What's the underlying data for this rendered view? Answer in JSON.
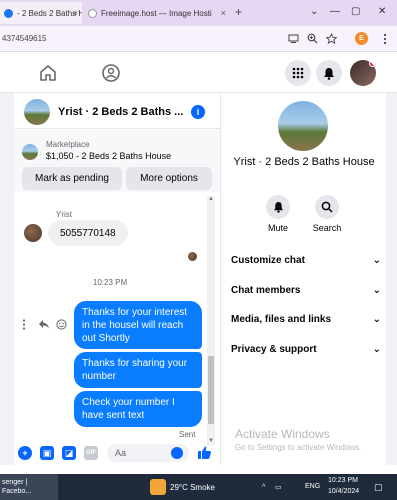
{
  "browser": {
    "tabs": [
      {
        "label": "- 2 Beds 2 Baths H",
        "close": "×"
      },
      {
        "label": "Freeimage.host — Image Hosti",
        "close": "×"
      }
    ],
    "new_tab": "+",
    "window_controls": [
      "⌄",
      "—",
      "▢",
      "✕"
    ],
    "url": "4374549615",
    "profile_initial": "E"
  },
  "chat": {
    "title": "Yrist · 2 Beds 2 Baths ...",
    "marketplace_label": "Marketplace",
    "listing": "$1,050 - 2 Beds 2 Baths House",
    "buttons": {
      "mark_pending": "Mark as pending",
      "more_options": "More options"
    },
    "messages_in": [
      {
        "sender": "Yrist",
        "text": "5055770148"
      }
    ],
    "timestamp": "10:23 PM",
    "messages_out": [
      "Thanks for your interest in the housel will reach out Shortly",
      "Thanks  for  sharing your number",
      "Check your number  I have  sent text"
    ],
    "sent_label": "Sent",
    "composer_placeholder": "Aa",
    "gif_label": "GIF"
  },
  "right_panel": {
    "title": "Yrist · 2 Beds 2 Baths House",
    "actions": [
      {
        "label": "Mute",
        "icon": "bell-icon"
      },
      {
        "label": "Search",
        "icon": "search-icon"
      }
    ],
    "sections": [
      "Customize chat",
      "Chat members",
      "Media, files and links",
      "Privacy & support"
    ],
    "activate_title": "Activate Windows",
    "activate_sub": "Go to Settings to activate Windows."
  },
  "taskbar": {
    "app_label": "senger | Facebo...",
    "weather": "29°C  Smoke",
    "lang": "ENG",
    "time": "10:23 PM",
    "date": "10/4/2024"
  },
  "colors": {
    "accent": "#0866ff",
    "bubble_out": "#0a7cff"
  }
}
